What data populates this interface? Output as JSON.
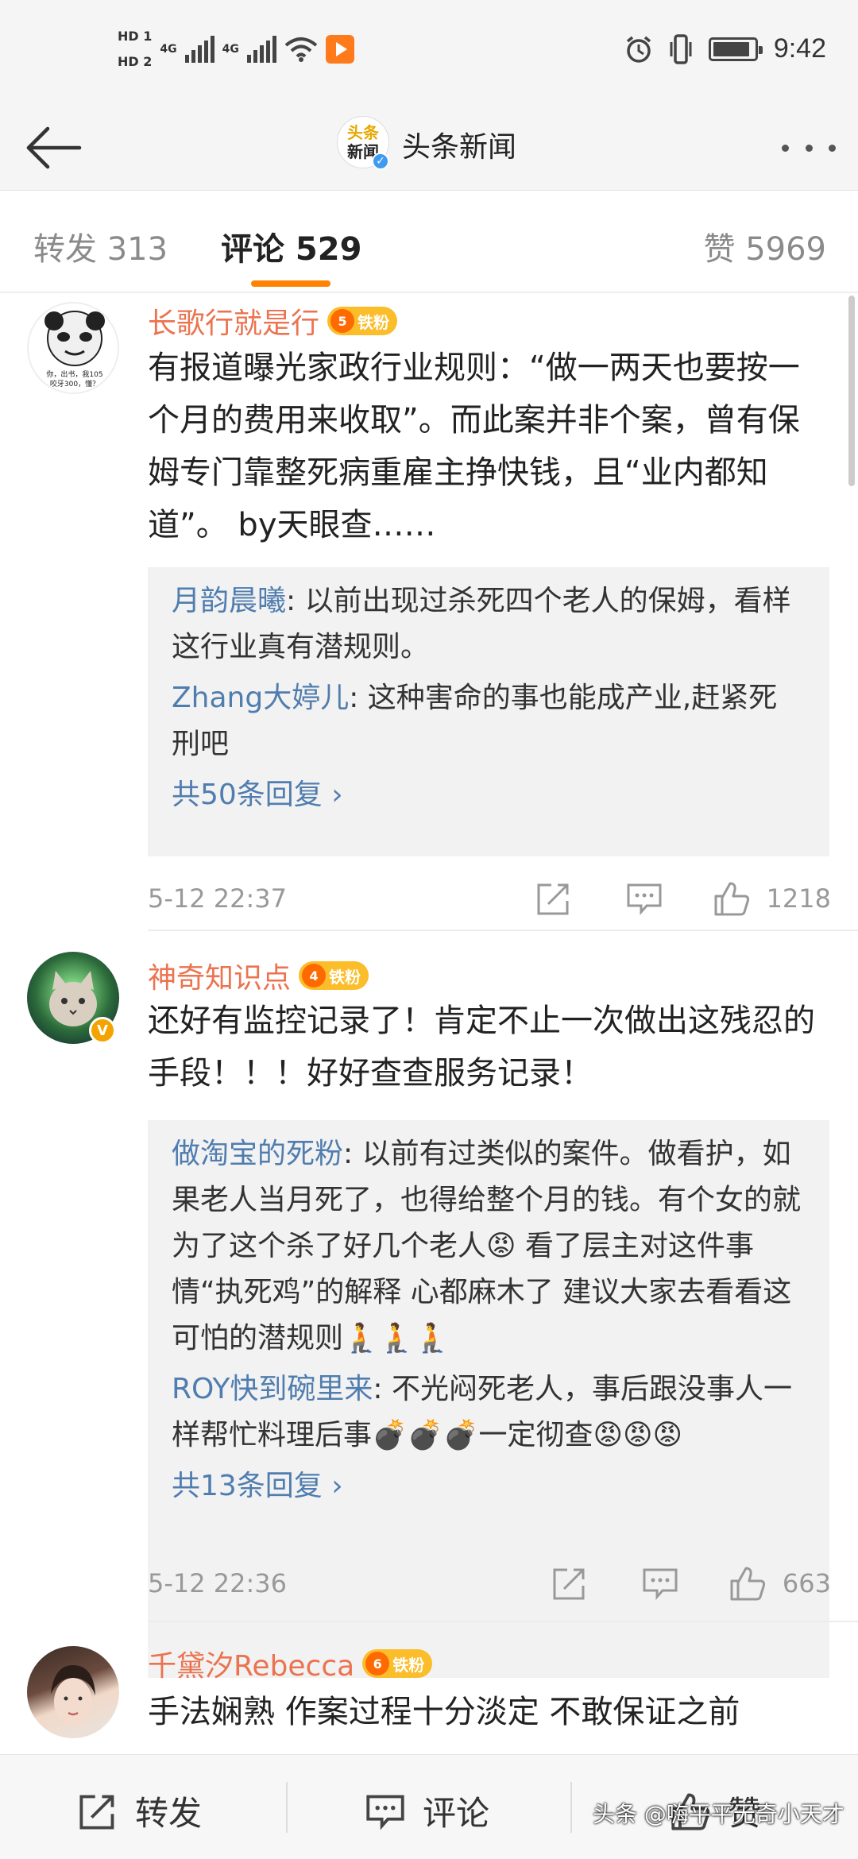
{
  "status_bar": {
    "hd1": "HD 1",
    "hd2": "HD 2",
    "net1": "4G",
    "net2": "4G",
    "time": "9:42"
  },
  "header": {
    "logo_line1": "头条",
    "logo_line2": "新闻",
    "title": "头条新闻"
  },
  "tabs": [
    {
      "label": "转发 313"
    },
    {
      "label": "评论 529"
    },
    {
      "label": "赞 5969"
    }
  ],
  "comments": [
    {
      "username": "长歌行就是行",
      "fan_level": "5",
      "fan_label": "铁粉",
      "avatar_caption": "你，出书，我105 咬牙300，懂？",
      "text": "有报道曝光家政行业规则：“做一两天也要按一个月的费用来收取”。而此案并非个案，曾有保姆专门靠整死病重雇主挣快钱，且“业内都知道”。 by天眼查……",
      "replies": [
        {
          "name": "月韵晨曦",
          "text": ": 以前出现过杀死四个老人的保姆，看样这行业真有潜规则。"
        },
        {
          "name": "Zhang大婷儿",
          "text": ": 这种害命的事也能成产业,赶紧死刑吧"
        }
      ],
      "more_replies": "共50条回复 ›",
      "date": "5-12 22:37",
      "likes": "1218"
    },
    {
      "username": "神奇知识点",
      "fan_level": "4",
      "fan_label": "铁粉",
      "text": "还好有监控记录了！肯定不止一次做出这残忍的手段！！！好好查查服务记录！",
      "replies": [
        {
          "name": "做淘宝的死粉",
          "text": ": 以前有过类似的案件。做看护，如果老人当月死了，也得给整个月的钱。有个女的就为了这个杀了好几个老人😡 看了层主对这件事情“执死鸡”的解释 心都麻木了 建议大家去看看这可怕的潜规则🧎🧎🧎"
        },
        {
          "name": "ROY快到碗里来",
          "text": ": 不光闷死老人，事后跟没事人一样帮忙料理后事💣💣💣一定彻查😡😡😡"
        }
      ],
      "more_replies": "共13条回复 ›",
      "date": "5-12 22:36",
      "likes": "663"
    },
    {
      "username": "千黛汐Rebecca",
      "fan_level": "6",
      "fan_label": "铁粉",
      "text": "手法娴熟 作案过程十分淡定 不敢保证之前"
    }
  ],
  "bottom_bar": {
    "repost": "转发",
    "comment": "评论",
    "like": "赞"
  },
  "watermark": "头条 @嗨平平无奇小天才",
  "colors": {
    "username": "#eb7350",
    "reply_name": "#507daf",
    "tab_indicator": "#ff8200",
    "fan_badge": "#fbbd2a"
  }
}
